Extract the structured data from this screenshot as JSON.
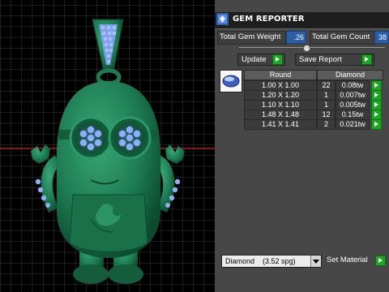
{
  "panel": {
    "title": "GEM REPORTER",
    "total_gem_weight_label": "Total Gem Weight",
    "total_gem_weight_value": ".26",
    "total_gem_count_label": "Total Gem Count",
    "total_gem_count_value": "38",
    "update_label": "Update",
    "save_report_label": "Save Report"
  },
  "table": {
    "header_shape": "Round",
    "header_material": "Diamond",
    "rows": [
      {
        "size": "1.00 X 1.00",
        "count": "22",
        "weight": "0.08tw"
      },
      {
        "size": "1.20 X 1.20",
        "count": "1",
        "weight": "0.007tw"
      },
      {
        "size": "1.10 X 1.10",
        "count": "1",
        "weight": "0.005tw"
      },
      {
        "size": "1.48 X 1.48",
        "count": "12",
        "weight": "0.15tw"
      },
      {
        "size": "1.41 X 1.41",
        "count": "2",
        "weight": "0.021tw"
      }
    ]
  },
  "material": {
    "selected_name": "Diamond",
    "selected_sg": "(3.52 spg)",
    "set_material_label": "Set Material"
  },
  "colors": {
    "model_green": "#1e7a52",
    "gem_blue": "#7a9ee8",
    "value_blue": "#2a5fa8",
    "play_green": "#1aa822"
  },
  "icons": {
    "title": "gem-reporter-icon",
    "update": "play-icon",
    "save_report": "play-icon",
    "row_action": "play-icon",
    "gem_shape": "round-gem-icon",
    "dropdown": "chevron-down-icon"
  }
}
